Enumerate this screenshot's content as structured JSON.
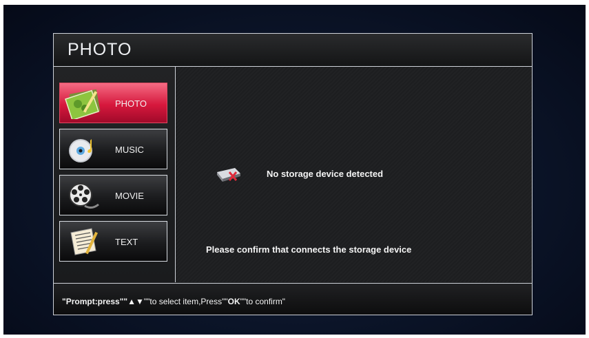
{
  "header": {
    "title": "PHOTO"
  },
  "sidebar": {
    "items": [
      {
        "label": "PHOTO",
        "icon": "photo-icon",
        "active": true
      },
      {
        "label": "MUSIC",
        "icon": "music-disc-icon",
        "active": false
      },
      {
        "label": "MOVIE",
        "icon": "film-reel-icon",
        "active": false
      },
      {
        "label": "TEXT",
        "icon": "text-document-icon",
        "active": false
      }
    ]
  },
  "content": {
    "status_icon": "no-storage-icon",
    "no_device_message": "No storage device detected",
    "confirm_message": "Please confirm that connects the storage device"
  },
  "prompt": {
    "part1": "\"Prompt:press\"\"",
    "arrows": "▲▼",
    "part2": "\"\"to select item,Press\"\"",
    "ok": "OK",
    "part3": "\"\"to confirm\""
  },
  "colors": {
    "active_item": "#d6183d",
    "border": "#cfd3da",
    "background": "#0b1428"
  }
}
